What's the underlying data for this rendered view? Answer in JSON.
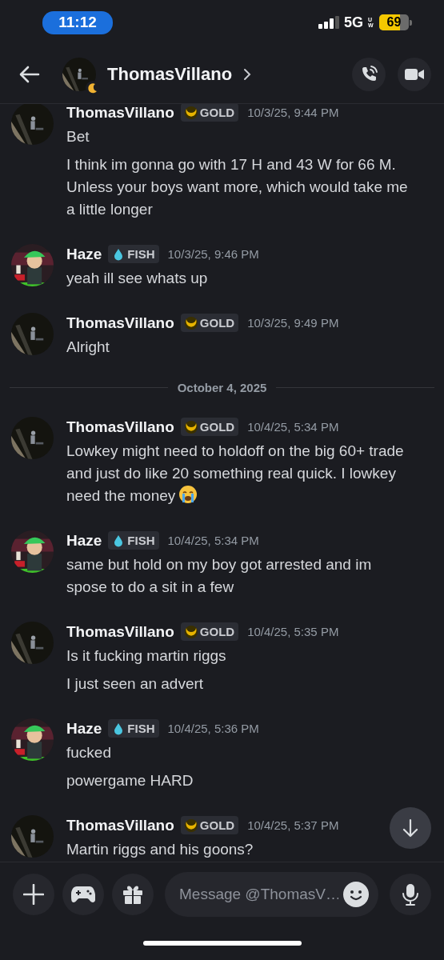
{
  "status_bar": {
    "time": "11:12",
    "network": "5G",
    "network_sub": "UW",
    "battery": "69"
  },
  "header": {
    "title": "ThomasVillano",
    "idle": true
  },
  "messages": [
    {
      "kind": "message",
      "author": "ThomasVillano",
      "tag": {
        "kind": "gold",
        "label": "GOLD"
      },
      "time": "10/3/25, 9:44 PM",
      "lines": [
        "Bet",
        "I think im gonna go with 17 H and 43 W for 66 M. Unless your boys want more, which would take me a little longer"
      ]
    },
    {
      "kind": "message",
      "author": "Haze",
      "tag": {
        "kind": "fish",
        "label": "FISH"
      },
      "time": "10/3/25, 9:46 PM",
      "lines": [
        "yeah ill see whats up"
      ]
    },
    {
      "kind": "message",
      "author": "ThomasVillano",
      "tag": {
        "kind": "gold",
        "label": "GOLD"
      },
      "time": "10/3/25, 9:49 PM",
      "lines": [
        "Alright"
      ]
    },
    {
      "kind": "divider",
      "label": "October 4, 2025"
    },
    {
      "kind": "message",
      "author": "ThomasVillano",
      "tag": {
        "kind": "gold",
        "label": "GOLD"
      },
      "time": "10/4/25, 5:34 PM",
      "lines": [
        "Lowkey might need to holdoff on the big 60+ trade and just do like 20 something real quick. I lowkey need the money"
      ],
      "crying_emoji": true
    },
    {
      "kind": "message",
      "author": "Haze",
      "tag": {
        "kind": "fish",
        "label": "FISH"
      },
      "time": "10/4/25, 5:34 PM",
      "lines": [
        "same but hold on my boy got arrested and im spose to do a sit in a few"
      ]
    },
    {
      "kind": "message",
      "author": "ThomasVillano",
      "tag": {
        "kind": "gold",
        "label": "GOLD"
      },
      "time": "10/4/25, 5:35 PM",
      "lines": [
        "Is it fucking martin riggs",
        "I just seen an advert"
      ]
    },
    {
      "kind": "message",
      "author": "Haze",
      "tag": {
        "kind": "fish",
        "label": "FISH"
      },
      "time": "10/4/25, 5:36 PM",
      "lines": [
        "fucked",
        "powergame HARD"
      ]
    },
    {
      "kind": "message",
      "author": "ThomasVillano",
      "tag": {
        "kind": "gold",
        "label": "GOLD"
      },
      "time": "10/4/25, 5:37 PM",
      "lines": [
        "Martin riggs and his goons?"
      ]
    }
  ],
  "composer": {
    "placeholder": "Message @ThomasV…"
  }
}
